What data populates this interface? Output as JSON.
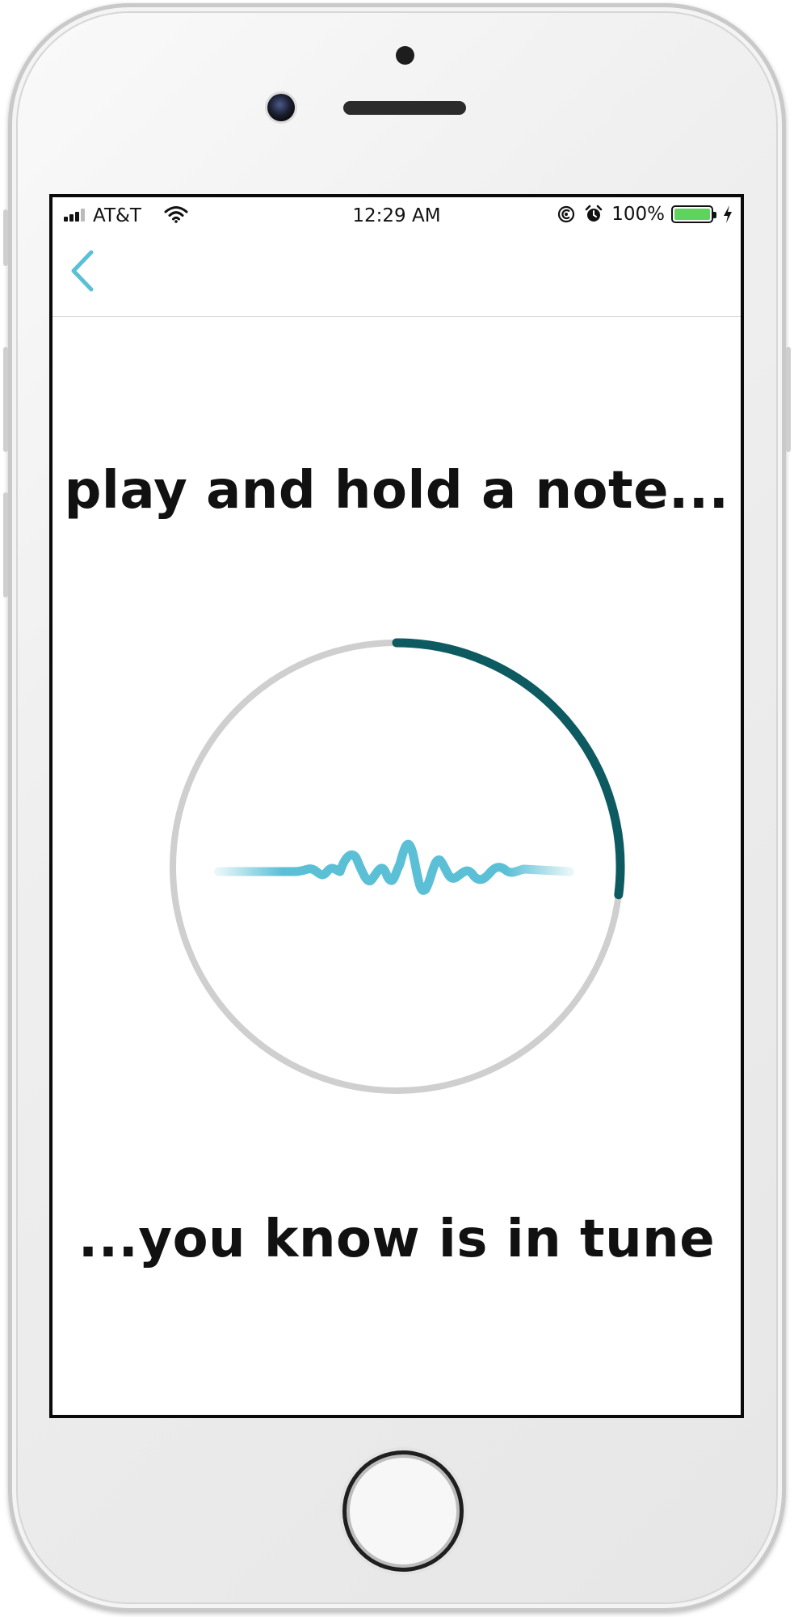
{
  "status_bar": {
    "carrier": "AT&T",
    "time": "12:29 AM",
    "battery_percent": "100%",
    "battery_color": "#5dd45d",
    "icons": [
      "signal-icon",
      "wifi-icon",
      "at-lock-icon",
      "alarm-icon",
      "battery-icon",
      "charging-icon"
    ]
  },
  "nav": {
    "back_icon": "chevron-left-icon",
    "accent_color": "#5bc0d6"
  },
  "main": {
    "prompt_top": "play and hold a note...",
    "prompt_bottom": "...you know is in tune",
    "tuner": {
      "progress": 0.27,
      "progress_color": "#0d5a61",
      "track_color": "#cfcfcf",
      "waveform_color": "#5bc0d6",
      "waveform_icon": "sound-wave-icon"
    }
  }
}
